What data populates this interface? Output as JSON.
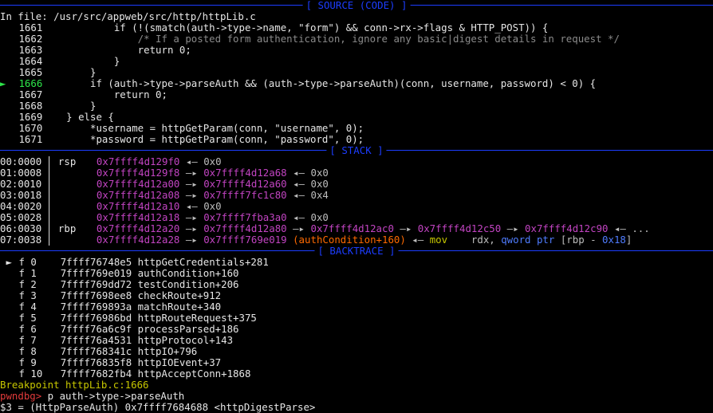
{
  "source": {
    "banner": "[ SOURCE (CODE) ]",
    "file_line": "In file: /usr/src/appweb/src/http/httpLib.c",
    "current_marker": "►",
    "lines": [
      {
        "n": "1661",
        "text": "            if (!(smatch(auth->type->name, \"form\") && conn->rx->flags & HTTP_POST)) {",
        "cur": false,
        "kind": "code"
      },
      {
        "n": "1662",
        "text": "                /* If a posted form authentication, ignore any basic|digest details in request */",
        "cur": false,
        "kind": "comment"
      },
      {
        "n": "1663",
        "text": "                return 0;",
        "cur": false,
        "kind": "code"
      },
      {
        "n": "1664",
        "text": "            }",
        "cur": false,
        "kind": "code"
      },
      {
        "n": "1665",
        "text": "        }",
        "cur": false,
        "kind": "code"
      },
      {
        "n": "1666",
        "text": "        if (auth->type->parseAuth && (auth->type->parseAuth)(conn, username, password) < 0) {",
        "cur": true,
        "kind": "code"
      },
      {
        "n": "1667",
        "text": "            return 0;",
        "cur": false,
        "kind": "code"
      },
      {
        "n": "1668",
        "text": "        }",
        "cur": false,
        "kind": "code"
      },
      {
        "n": "1669",
        "text": "    } else {",
        "cur": false,
        "kind": "code"
      },
      {
        "n": "1670",
        "text": "        *username = httpGetParam(conn, \"username\", 0);",
        "cur": false,
        "kind": "code"
      },
      {
        "n": "1671",
        "text": "        *password = httpGetParam(conn, \"password\", 0);",
        "cur": false,
        "kind": "code"
      }
    ]
  },
  "stack": {
    "banner": "[ STACK ]",
    "rows": [
      {
        "off": "00:0000",
        "reg": "rsp",
        "chain": [
          {
            "c": "addr",
            "t": "0x7ffff4d129f0"
          },
          {
            "c": "dim",
            "t": " ◂— "
          },
          {
            "c": "dim",
            "t": "0x0"
          }
        ]
      },
      {
        "off": "01:0008",
        "reg": "",
        "chain": [
          {
            "c": "addr",
            "t": "0x7ffff4d129f8"
          },
          {
            "c": "dim",
            "t": " —▸ "
          },
          {
            "c": "addr",
            "t": "0x7ffff4d12a68"
          },
          {
            "c": "dim",
            "t": " ◂— "
          },
          {
            "c": "dim",
            "t": "0x0"
          }
        ]
      },
      {
        "off": "02:0010",
        "reg": "",
        "chain": [
          {
            "c": "addr",
            "t": "0x7ffff4d12a00"
          },
          {
            "c": "dim",
            "t": " —▸ "
          },
          {
            "c": "addr",
            "t": "0x7ffff4d12a60"
          },
          {
            "c": "dim",
            "t": " ◂— "
          },
          {
            "c": "dim",
            "t": "0x0"
          }
        ]
      },
      {
        "off": "03:0018",
        "reg": "",
        "chain": [
          {
            "c": "addr",
            "t": "0x7ffff4d12a08"
          },
          {
            "c": "dim",
            "t": " —▸ "
          },
          {
            "c": "addr",
            "t": "0x7ffff7fc1c80"
          },
          {
            "c": "dim",
            "t": " ◂— "
          },
          {
            "c": "dim",
            "t": "0x4"
          }
        ]
      },
      {
        "off": "04:0020",
        "reg": "",
        "chain": [
          {
            "c": "addr",
            "t": "0x7ffff4d12a10"
          },
          {
            "c": "dim",
            "t": " ◂— "
          },
          {
            "c": "dim",
            "t": "0x0"
          }
        ]
      },
      {
        "off": "05:0028",
        "reg": "",
        "chain": [
          {
            "c": "addr",
            "t": "0x7ffff4d12a18"
          },
          {
            "c": "dim",
            "t": " —▸ "
          },
          {
            "c": "addr",
            "t": "0x7ffff7fba3a0"
          },
          {
            "c": "dim",
            "t": " ◂— "
          },
          {
            "c": "dim",
            "t": "0x0"
          }
        ]
      },
      {
        "off": "06:0030",
        "reg": "rbp",
        "chain": [
          {
            "c": "addr",
            "t": "0x7ffff4d12a20"
          },
          {
            "c": "dim",
            "t": " —▸ "
          },
          {
            "c": "addr",
            "t": "0x7ffff4d12a80"
          },
          {
            "c": "dim",
            "t": " —▸ "
          },
          {
            "c": "addr",
            "t": "0x7ffff4d12ac0"
          },
          {
            "c": "dim",
            "t": " —▸ "
          },
          {
            "c": "addr",
            "t": "0x7ffff4d12c50"
          },
          {
            "c": "dim",
            "t": " —▸ "
          },
          {
            "c": "addr",
            "t": "0x7ffff4d12c90"
          },
          {
            "c": "dim",
            "t": " ◂— ..."
          }
        ]
      },
      {
        "off": "07:0038",
        "reg": "",
        "chain": [
          {
            "c": "addr",
            "t": "0x7ffff4d12a28"
          },
          {
            "c": "dim",
            "t": " —▸ "
          },
          {
            "c": "addr",
            "t": "0x7ffff769e019"
          },
          {
            "c": "sym",
            "t": " (authCondition+160)"
          },
          {
            "c": "dim",
            "t": " ◂— "
          },
          {
            "c": "yel",
            "t": "mov    "
          },
          {
            "c": "dim",
            "t": "rdx, "
          },
          {
            "c": "kw",
            "t": "qword ptr "
          },
          {
            "c": "dim",
            "t": "[rbp - "
          },
          {
            "c": "kw",
            "t": "0x18"
          },
          {
            "c": "dim",
            "t": "]"
          }
        ]
      }
    ]
  },
  "backtrace": {
    "banner": "[ BACKTRACE ]",
    "frames": [
      {
        "mark": "►",
        "frame": "f 0",
        "addr": "7ffff76748e5",
        "sym": "httpGetCredentials+281"
      },
      {
        "mark": "",
        "frame": "f 1",
        "addr": "7ffff769e019",
        "sym": "authCondition+160"
      },
      {
        "mark": "",
        "frame": "f 2",
        "addr": "7ffff769dd72",
        "sym": "testCondition+206"
      },
      {
        "mark": "",
        "frame": "f 3",
        "addr": "7ffff7698ee8",
        "sym": "checkRoute+912"
      },
      {
        "mark": "",
        "frame": "f 4",
        "addr": "7ffff769893a",
        "sym": "matchRoute+340"
      },
      {
        "mark": "",
        "frame": "f 5",
        "addr": "7ffff76986bd",
        "sym": "httpRouteRequest+375"
      },
      {
        "mark": "",
        "frame": "f 6",
        "addr": "7ffff76a6c9f",
        "sym": "processParsed+186"
      },
      {
        "mark": "",
        "frame": "f 7",
        "addr": "7ffff76a4531",
        "sym": "httpProtocol+143"
      },
      {
        "mark": "",
        "frame": "f 8",
        "addr": "7ffff768341c",
        "sym": "httpIO+796"
      },
      {
        "mark": "",
        "frame": "f 9",
        "addr": "7ffff76835f8",
        "sym": "httpIOEvent+37"
      },
      {
        "mark": "",
        "frame": "f 10",
        "addr": "7ffff7682fb4",
        "sym": "httpAcceptConn+1868"
      }
    ]
  },
  "console": {
    "breakpoint": "Breakpoint httpLib.c:1666",
    "prompt": "pwndbg>",
    "command": " p auth->type->parseAuth",
    "result": "$3 = (HttpParseAuth) 0x7ffff7684688 <httpDigestParse>"
  }
}
